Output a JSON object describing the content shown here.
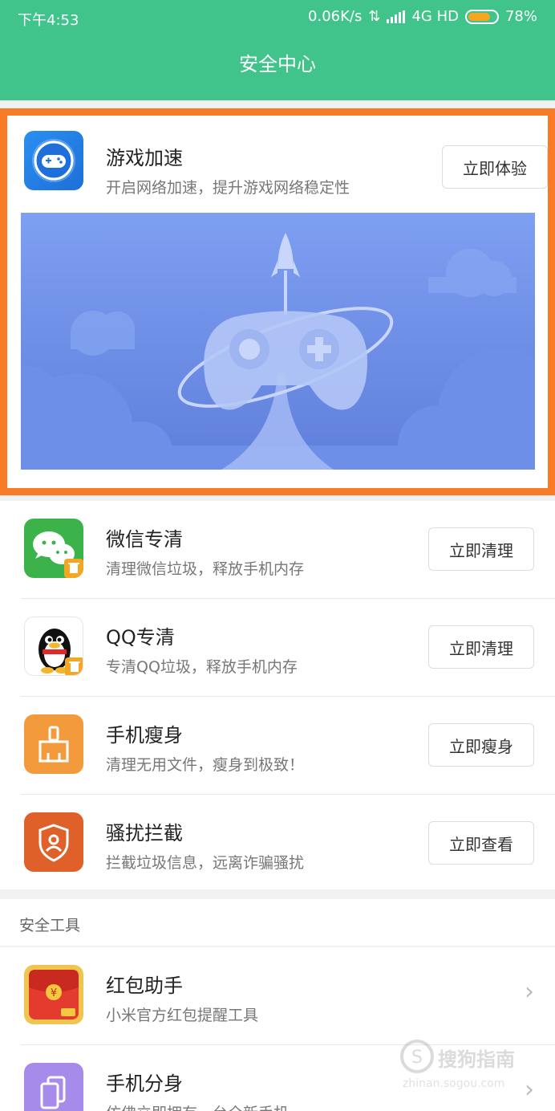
{
  "status_bar": {
    "time": "下午4:53",
    "network_speed": "0.06K/s",
    "network_type": "4G HD",
    "battery_percent": "78%",
    "battery_level": 0.78
  },
  "page": {
    "title": "安全中心"
  },
  "featured": {
    "name": "游戏加速",
    "desc": "开启网络加速，提升游戏网络稳定性",
    "button": "立即体验",
    "icon": "gamepad-icon",
    "banner_colors": [
      "#7e9ff2",
      "#5f7fdb"
    ]
  },
  "features": [
    {
      "name": "微信专清",
      "desc": "清理微信垃圾，释放手机内存",
      "button": "立即清理",
      "icon": "wechat-icon"
    },
    {
      "name": "QQ专清",
      "desc": "专清QQ垃圾，释放手机内存",
      "button": "立即清理",
      "icon": "qq-penguin-icon"
    },
    {
      "name": "手机瘦身",
      "desc": "清理无用文件，瘦身到极致！",
      "button": "立即瘦身",
      "icon": "broom-icon"
    },
    {
      "name": "骚扰拦截",
      "desc": "拦截垃圾信息，远离诈骗骚扰",
      "button": "立即查看",
      "icon": "shield-icon"
    }
  ],
  "tools_section": {
    "label": "安全工具",
    "items": [
      {
        "name": "红包助手",
        "desc": "小米官方红包提醒工具",
        "icon": "red-envelope-icon"
      },
      {
        "name": "手机分身",
        "desc": "仿佛立即拥有一台全新手机",
        "icon": "phone-clone-icon"
      }
    ]
  },
  "watermark": {
    "title": "搜狗指南",
    "url": "zhinan.sogou.com"
  },
  "colors": {
    "header": "#41c38c",
    "highlight": "#f97a26",
    "battery": "#f5a623"
  }
}
